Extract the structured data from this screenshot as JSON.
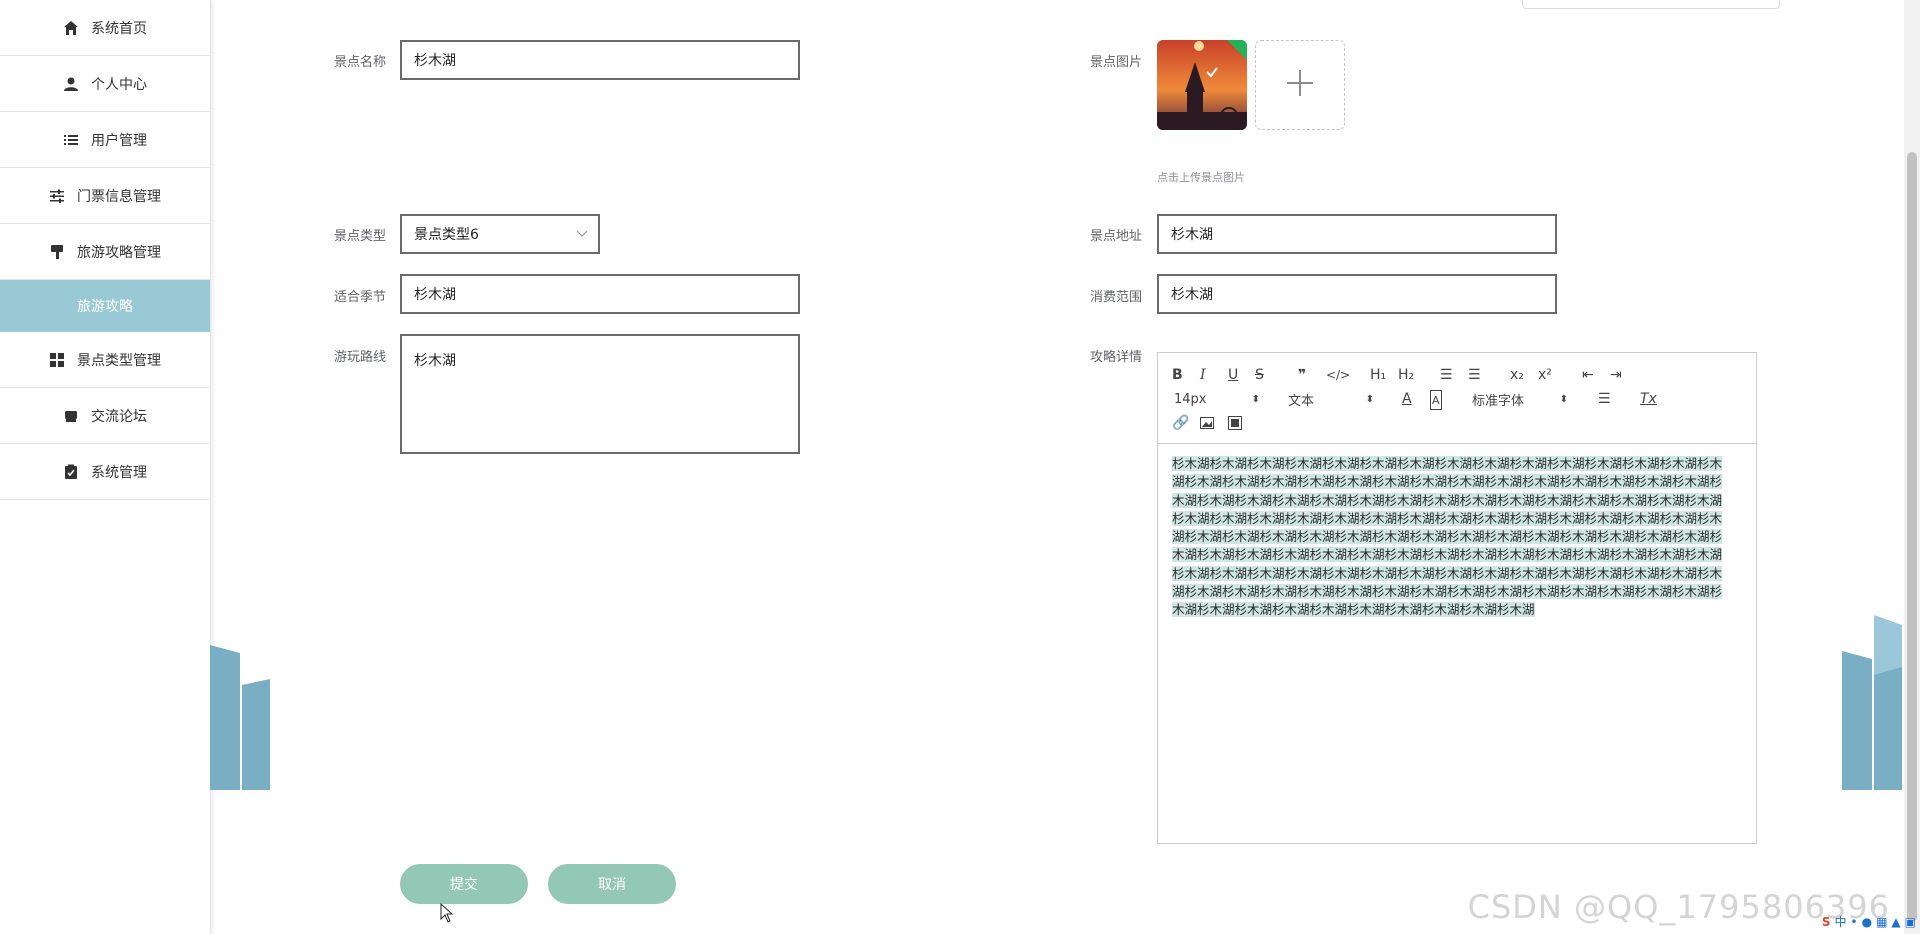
{
  "sidebar": {
    "items": [
      {
        "label": "系统首页",
        "icon": "home-icon"
      },
      {
        "label": "个人中心",
        "icon": "user-icon"
      },
      {
        "label": "用户管理",
        "icon": "list-icon"
      },
      {
        "label": "门票信息管理",
        "icon": "sliders-icon"
      },
      {
        "label": "旅游攻略管理",
        "icon": "brush-icon"
      }
    ],
    "active_sub": "旅游攻略",
    "items_after": [
      {
        "label": "景点类型管理",
        "icon": "grid-icon"
      },
      {
        "label": "交流论坛",
        "icon": "message-icon"
      },
      {
        "label": "系统管理",
        "icon": "clipboard-icon"
      }
    ]
  },
  "form": {
    "name_label": "景点名称",
    "name_value": "杉木湖",
    "image_label": "景点图片",
    "image_hint": "点击上传景点图片",
    "type_label": "景点类型",
    "type_value": "景点类型6",
    "address_label": "景点地址",
    "address_value": "杉木湖",
    "season_label": "适合季节",
    "season_value": "杉木湖",
    "cost_label": "消费范围",
    "cost_value": "杉木湖",
    "route_label": "游玩路线",
    "route_value": "杉木湖",
    "detail_label": "攻略详情"
  },
  "editor": {
    "font_size": "14px",
    "block_type": "文本",
    "font_family": "标准字体",
    "content": "杉木湖杉木湖杉木湖杉木湖杉木湖杉木湖杉木湖杉木湖杉木湖杉木湖杉木湖杉木湖杉木湖杉木湖杉木湖杉木湖杉木湖杉木湖杉木湖杉木湖杉木湖杉木湖杉木湖杉木湖杉木湖杉木湖杉木湖杉木湖杉木湖杉木湖杉木湖杉木湖杉木湖杉木湖杉木湖杉木湖杉木湖杉木湖杉木湖杉木湖杉木湖杉木湖杉木湖杉木湖杉木湖杉木湖杉木湖杉木湖杉木湖杉木湖杉木湖杉木湖杉木湖杉木湖杉木湖杉木湖杉木湖杉木湖杉木湖杉木湖杉木湖杉木湖杉木湖杉木湖杉木湖杉木湖杉木湖杉木湖杉木湖杉木湖杉木湖杉木湖杉木湖杉木湖杉木湖杉木湖杉木湖杉木湖杉木湖杉木湖杉木湖杉木湖杉木湖杉木湖杉木湖杉木湖杉木湖杉木湖杉木湖杉木湖杉木湖杉木湖杉木湖杉木湖杉木湖杉木湖杉木湖杉木湖杉木湖杉木湖杉木湖杉木湖杉木湖杉木湖杉木湖杉木湖杉木湖杉木湖杉木湖杉木湖杉木湖杉木湖杉木湖杉木湖杉木湖杉木湖杉木湖杉木湖杉木湖杉木湖杉木湖杉木湖杉木湖杉木湖杉木湖杉木湖杉木湖"
  },
  "buttons": {
    "submit": "提交",
    "cancel": "取消"
  },
  "watermark": "CSDN @QQ_1795806396",
  "colors": {
    "accent": "#94c8b6",
    "sidebar_active": "#9ac9d6",
    "deco": "#7aaec4"
  }
}
